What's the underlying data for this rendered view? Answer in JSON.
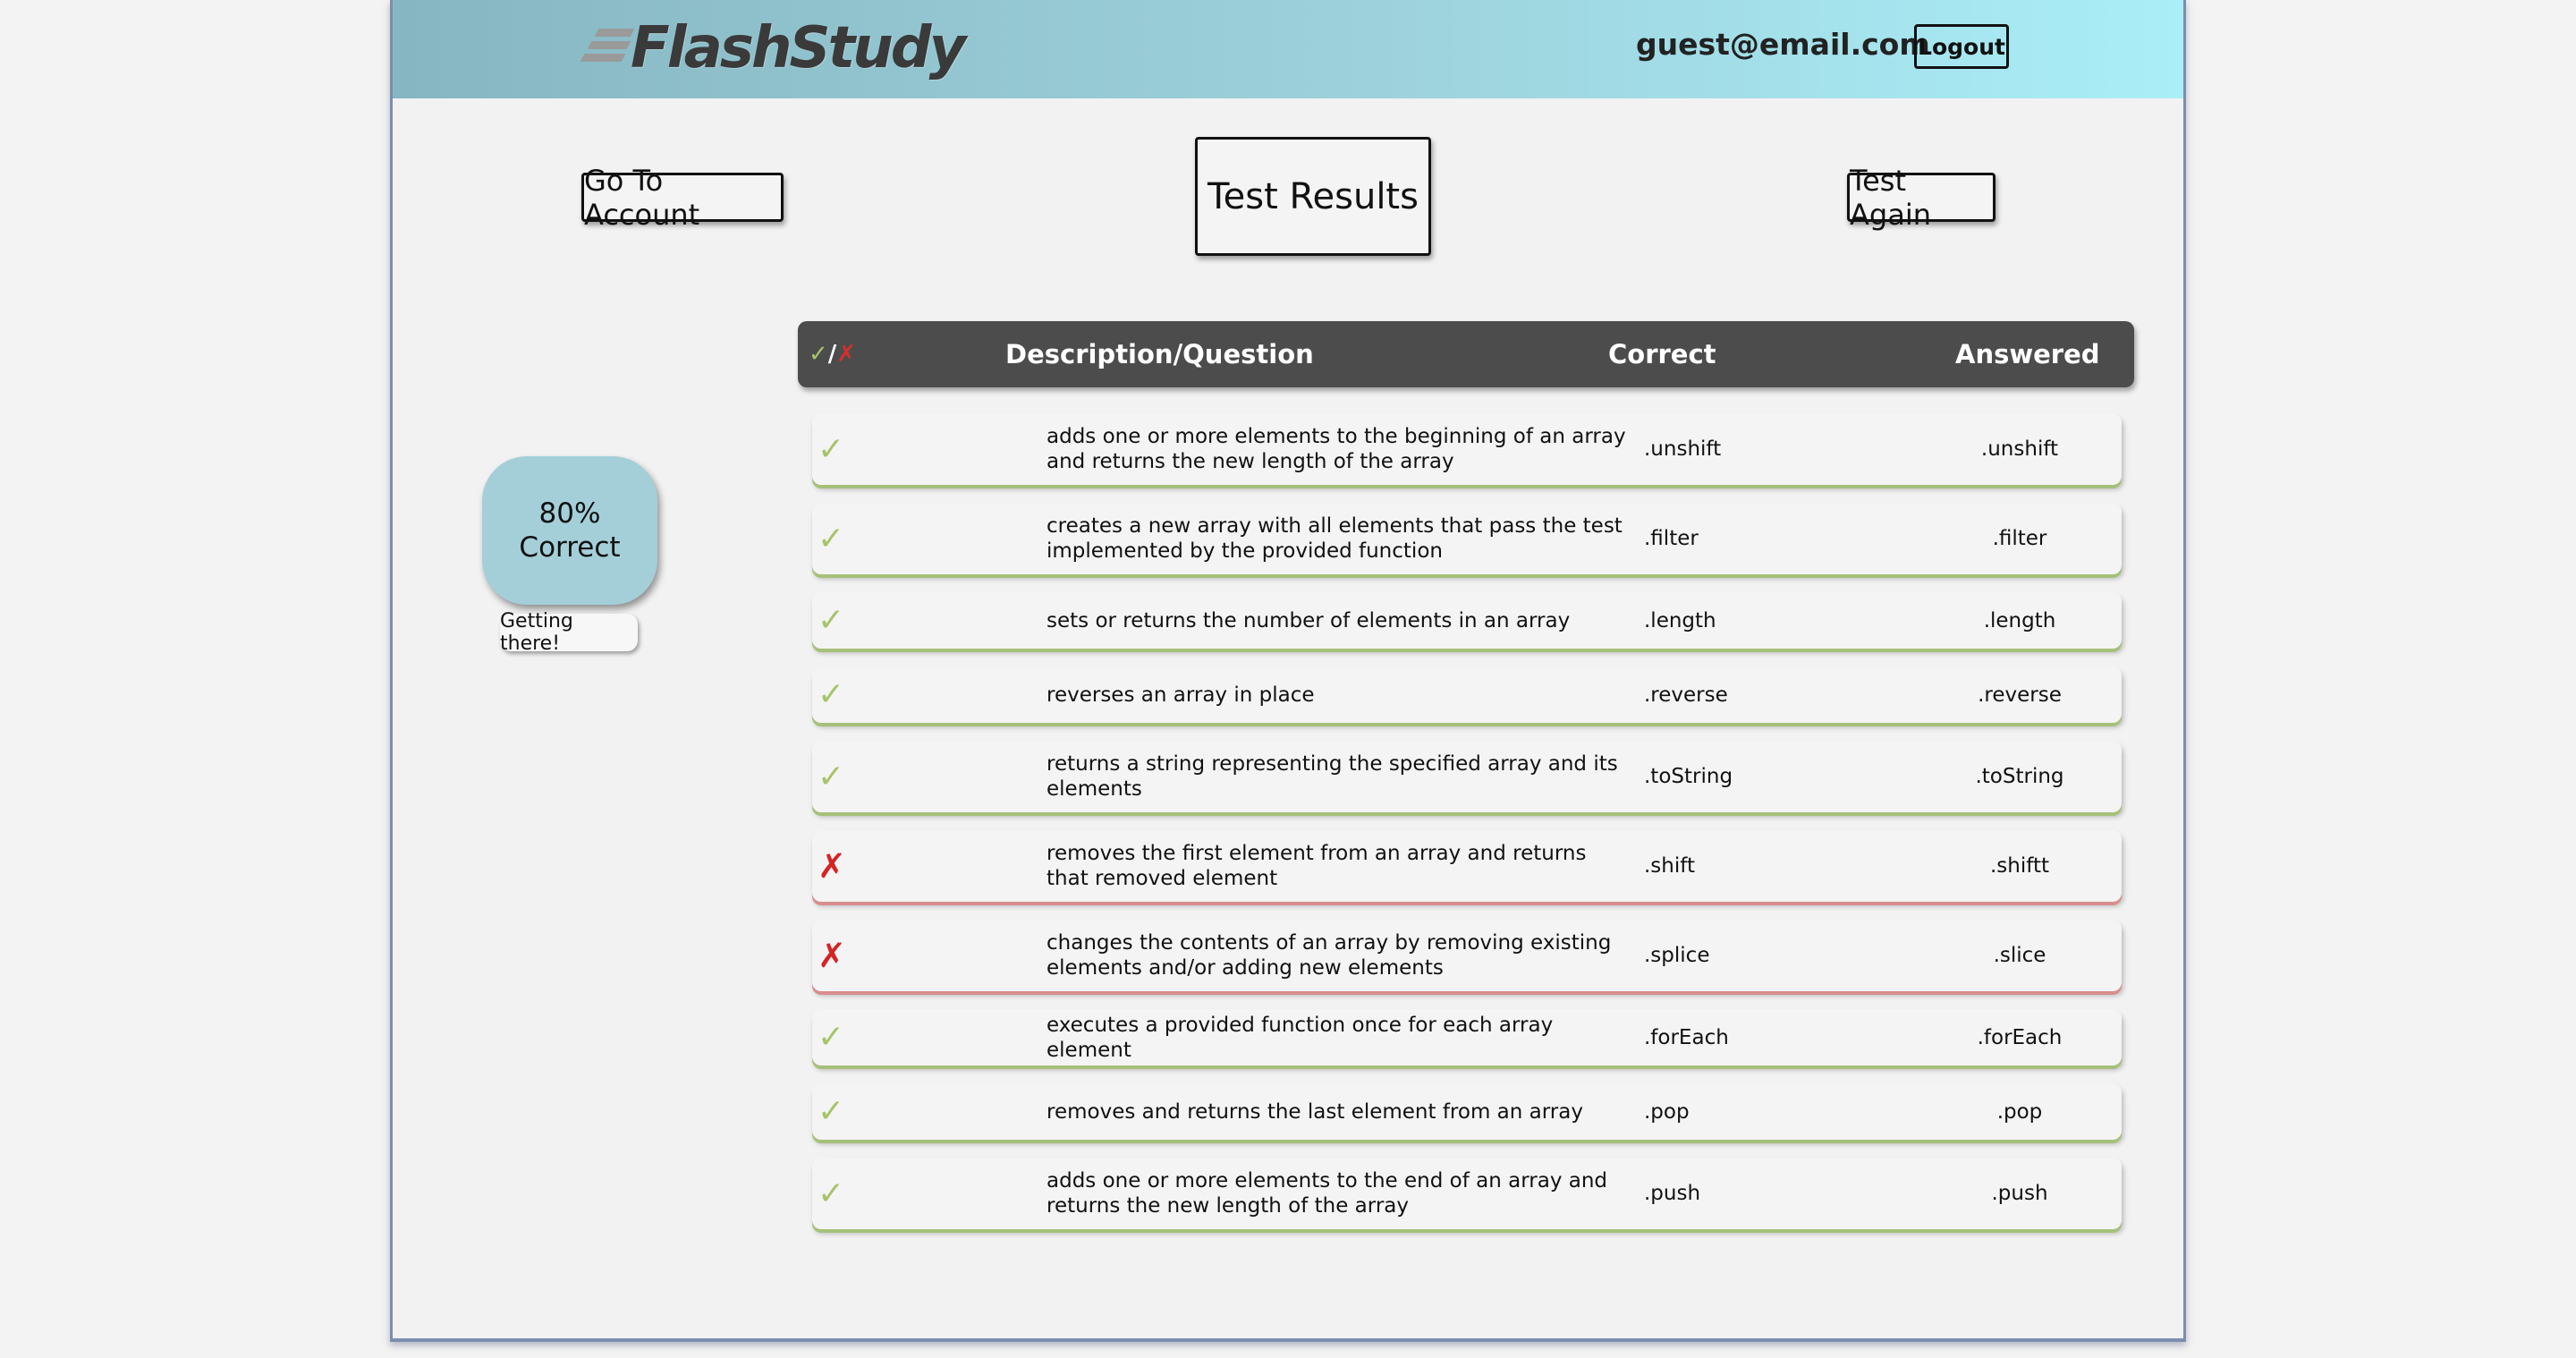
{
  "header": {
    "logo_text": "FlashStudy",
    "user_email": "guest@email.com",
    "logout_label": "Logout"
  },
  "toolbar": {
    "account_label": "Go To Account",
    "title_label": "Test Results",
    "again_label": "Test Again"
  },
  "score": {
    "percent_text": "80%",
    "correct_text": "Correct",
    "message": "Getting there!"
  },
  "table": {
    "headers": {
      "mark_ok": "✓",
      "mark_sep": "/",
      "mark_bad": "✗",
      "description": "Description/Question",
      "correct": "Correct",
      "answered": "Answered"
    },
    "rows": [
      {
        "status": "correct",
        "mark": "✓",
        "description": "adds one or more elements to the beginning of an array and returns the new length of the array",
        "correct": ".unshift",
        "answered": ".unshift"
      },
      {
        "status": "correct",
        "mark": "✓",
        "description": "creates a new array with all elements that pass the test implemented by the provided function",
        "correct": ".filter",
        "answered": ".filter"
      },
      {
        "status": "correct",
        "mark": "✓",
        "description": "sets or returns the number of elements in an array",
        "correct": ".length",
        "answered": ".length"
      },
      {
        "status": "correct",
        "mark": "✓",
        "description": "reverses an array in place",
        "correct": ".reverse",
        "answered": ".reverse"
      },
      {
        "status": "correct",
        "mark": "✓",
        "description": "returns a string representing the specified array and its elements",
        "correct": ".toString",
        "answered": ".toString"
      },
      {
        "status": "incorrect",
        "mark": "✗",
        "description": "removes the first element from an array and returns that removed element",
        "correct": ".shift",
        "answered": ".shiftt"
      },
      {
        "status": "incorrect",
        "mark": "✗",
        "description": "changes the contents of an array by removing existing elements and/or adding new elements",
        "correct": ".splice",
        "answered": ".slice"
      },
      {
        "status": "correct",
        "mark": "✓",
        "description": "executes a provided function once for each array element",
        "correct": ".forEach",
        "answered": ".forEach"
      },
      {
        "status": "correct",
        "mark": "✓",
        "description": "removes and returns the last element from an array",
        "correct": ".pop",
        "answered": ".pop"
      },
      {
        "status": "correct",
        "mark": "✓",
        "description": "adds one or more elements to the end of an array and returns the new length of the array",
        "correct": ".push",
        "answered": ".push"
      }
    ]
  },
  "colors": {
    "header_gradient_start": "#86b6c2",
    "header_gradient_end": "#aaeef8",
    "correct_green": "#a7c46a",
    "incorrect_red": "#d42424",
    "score_box": "#a4cfd9",
    "table_header": "#4c4c4c"
  }
}
